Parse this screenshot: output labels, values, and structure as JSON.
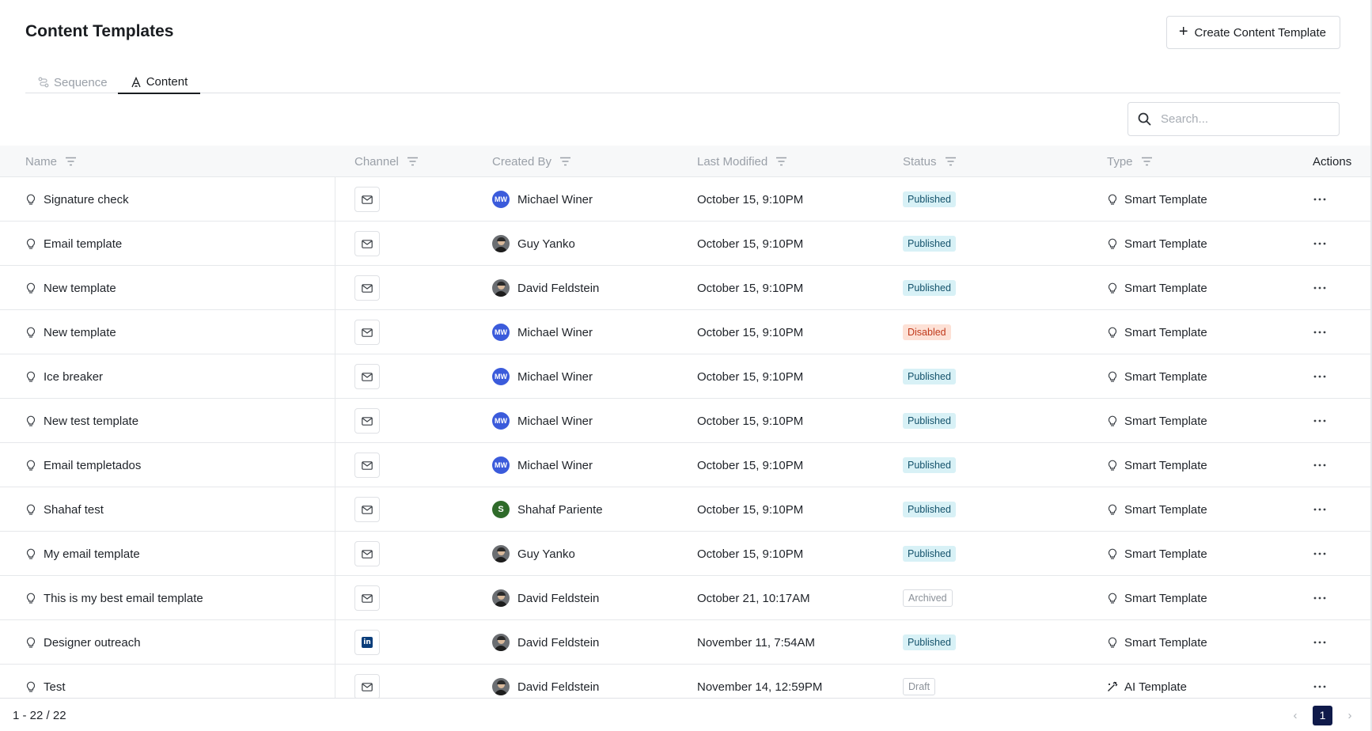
{
  "page": {
    "title": "Content Templates"
  },
  "header": {
    "create_button": "Create Content Template"
  },
  "tabs": [
    {
      "label": "Sequence",
      "active": false
    },
    {
      "label": "Content",
      "active": true
    }
  ],
  "search": {
    "placeholder": "Search..."
  },
  "columns": {
    "name": "Name",
    "channel": "Channel",
    "created_by": "Created By",
    "last_modified": "Last Modified",
    "status": "Status",
    "type": "Type",
    "actions": "Actions"
  },
  "rows": [
    {
      "name": "Signature check",
      "channel": "email",
      "creator": "Michael Winer",
      "avatar": "MW",
      "modified": "October 15, 9:10PM",
      "status": "Published",
      "type": "Smart Template"
    },
    {
      "name": "Email template",
      "channel": "email",
      "creator": "Guy Yanko",
      "avatar": "photo",
      "modified": "October 15, 9:10PM",
      "status": "Published",
      "type": "Smart Template"
    },
    {
      "name": "New template",
      "channel": "email",
      "creator": "David Feldstein",
      "avatar": "photo",
      "modified": "October 15, 9:10PM",
      "status": "Published",
      "type": "Smart Template"
    },
    {
      "name": "New template",
      "channel": "email",
      "creator": "Michael Winer",
      "avatar": "MW",
      "modified": "October 15, 9:10PM",
      "status": "Disabled",
      "type": "Smart Template"
    },
    {
      "name": "Ice breaker",
      "channel": "email",
      "creator": "Michael Winer",
      "avatar": "MW",
      "modified": "October 15, 9:10PM",
      "status": "Published",
      "type": "Smart Template"
    },
    {
      "name": "New test template",
      "channel": "email",
      "creator": "Michael Winer",
      "avatar": "MW",
      "modified": "October 15, 9:10PM",
      "status": "Published",
      "type": "Smart Template"
    },
    {
      "name": "Email templetados",
      "channel": "email",
      "creator": "Michael Winer",
      "avatar": "MW",
      "modified": "October 15, 9:10PM",
      "status": "Published",
      "type": "Smart Template"
    },
    {
      "name": "Shahaf test",
      "channel": "email",
      "creator": "Shahaf Pariente",
      "avatar": "S",
      "modified": "October 15, 9:10PM",
      "status": "Published",
      "type": "Smart Template"
    },
    {
      "name": "My email template",
      "channel": "email",
      "creator": "Guy Yanko",
      "avatar": "photo",
      "modified": "October 15, 9:10PM",
      "status": "Published",
      "type": "Smart Template"
    },
    {
      "name": "This is my best email template",
      "channel": "email",
      "creator": "David Feldstein",
      "avatar": "photo",
      "modified": "October 21, 10:17AM",
      "status": "Archived",
      "type": "Smart Template"
    },
    {
      "name": "Designer outreach",
      "channel": "linkedin",
      "creator": "David Feldstein",
      "avatar": "photo",
      "modified": "November 11, 7:54AM",
      "status": "Published",
      "type": "Smart Template"
    },
    {
      "name": "Test",
      "channel": "email",
      "creator": "David Feldstein",
      "avatar": "photo",
      "modified": "November 14, 12:59PM",
      "status": "Draft",
      "type": "AI Template"
    }
  ],
  "footer": {
    "range": "1 - 22 / 22",
    "current_page": "1"
  },
  "icons": {
    "linkedin_text": "in"
  }
}
